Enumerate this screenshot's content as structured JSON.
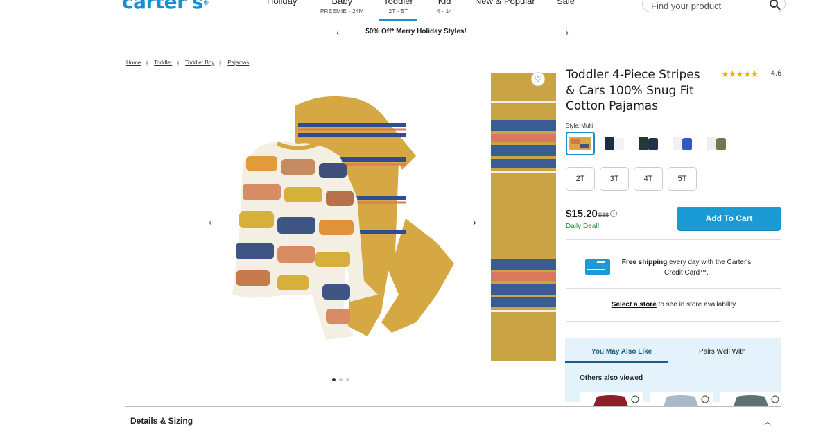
{
  "header": {
    "logo": "carter's",
    "nav": [
      {
        "label": "Holiday",
        "sub": ""
      },
      {
        "label": "Baby",
        "sub": "PREEMIE - 24M"
      },
      {
        "label": "Toddler",
        "sub": "2T - 5T"
      },
      {
        "label": "Kid",
        "sub": "4 - 14"
      },
      {
        "label": "New & Popular",
        "sub": ""
      },
      {
        "label": "Sale",
        "sub": ""
      }
    ],
    "search_placeholder": "Find your product"
  },
  "promo": {
    "text": "50% Off* Merry Holiday Styles!"
  },
  "breadcrumb": [
    "Home",
    "Toddler",
    "Toddler Boy",
    "Pajamas"
  ],
  "product": {
    "title": "Toddler 4-Piece Stripes & Cars 100% Snug Fit Cotton Pajamas",
    "rating": "4.6",
    "stars": "★★★★★",
    "style_label": "Style: Multi",
    "sizes": [
      "2T",
      "3T",
      "4T",
      "5T"
    ],
    "price": "$15.20",
    "was_price": "$38",
    "deal": "Daily Deal!",
    "add_to_cart": "Add To Cart"
  },
  "shipping": {
    "bold": "Free shipping",
    "text": " every day with the Carter's Credit Card™."
  },
  "store": {
    "link": "Select a store",
    "text": " to see in store availability"
  },
  "recommendations": {
    "tabs": [
      "You May Also Like",
      "Pairs Well With"
    ],
    "heading": "Others also viewed"
  },
  "details": {
    "label": "Details & Sizing"
  },
  "colors": {
    "brand": "#1a8fd0",
    "cta": "#1a9bd6",
    "deal": "#1f8a3a"
  }
}
